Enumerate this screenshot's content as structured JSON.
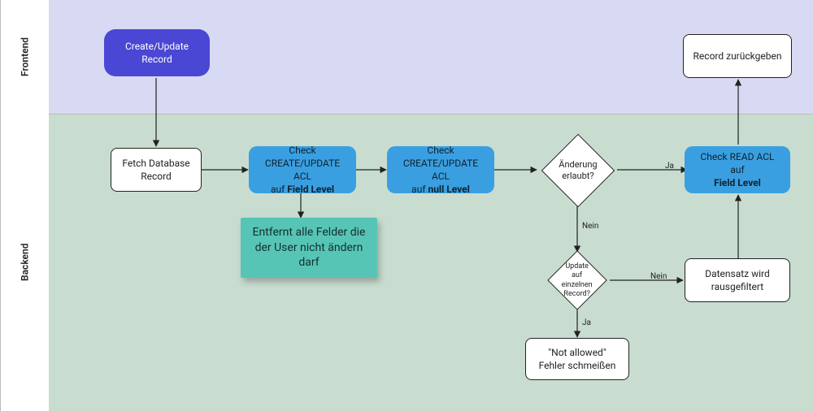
{
  "lanes": {
    "frontend": "Frontend",
    "backend": "Backend"
  },
  "nodes": {
    "create_update": "Create/Update Record",
    "fetch_db": "Fetch Database Record",
    "check_field_acl_pre": "Check",
    "check_field_acl_line2": "CREATE/UPDATE ACL",
    "check_field_acl_line3_a": "auf ",
    "check_field_acl_line3_b": "Field Level",
    "check_null_acl_pre": "Check",
    "check_null_acl_line2": "CREATE/UPDATE ACL",
    "check_null_acl_line3_a": "auf ",
    "check_null_acl_line3_b": "null Level",
    "sticky_note": "Entfernt alle Felder die der User nicht ändern darf",
    "change_allowed": "Änderung erlaubt?",
    "single_record": "Update auf einzelnen Record?",
    "not_allowed": "\"Not allowed\" Fehler schmeißen",
    "filtered_out": "Datensatz wird rausgefiltert",
    "check_read_acl_a": "Check READ ACL auf",
    "check_read_acl_b": "Field Level",
    "return_record": "Record zurückgeben"
  },
  "edges": {
    "yes": "Ja",
    "no": "Nein"
  },
  "chart_data": {
    "type": "flowchart",
    "title": "ACL Check Flow for Record Create/Update",
    "lanes": [
      {
        "id": "frontend",
        "label": "Frontend"
      },
      {
        "id": "backend",
        "label": "Backend"
      }
    ],
    "nodes": [
      {
        "id": "create_update",
        "lane": "frontend",
        "type": "process-start",
        "label": "Create/Update Record"
      },
      {
        "id": "fetch_db",
        "lane": "backend",
        "type": "process",
        "label": "Fetch Database Record"
      },
      {
        "id": "check_field_acl",
        "lane": "backend",
        "type": "process",
        "label": "Check CREATE/UPDATE ACL auf Field Level"
      },
      {
        "id": "sticky",
        "lane": "backend",
        "type": "note",
        "label": "Entfernt alle Felder die der User nicht ändern darf"
      },
      {
        "id": "check_null_acl",
        "lane": "backend",
        "type": "process",
        "label": "Check CREATE/UPDATE ACL auf null Level"
      },
      {
        "id": "change_allowed",
        "lane": "backend",
        "type": "decision",
        "label": "Änderung erlaubt?"
      },
      {
        "id": "single_record",
        "lane": "backend",
        "type": "decision",
        "label": "Update auf einzelnen Record?"
      },
      {
        "id": "not_allowed",
        "lane": "backend",
        "type": "process",
        "label": "\"Not allowed\" Fehler schmeißen"
      },
      {
        "id": "filtered_out",
        "lane": "backend",
        "type": "process",
        "label": "Datensatz wird rausgefiltert"
      },
      {
        "id": "check_read_acl",
        "lane": "backend",
        "type": "process",
        "label": "Check READ ACL auf Field Level"
      },
      {
        "id": "return_record",
        "lane": "frontend",
        "type": "process-end",
        "label": "Record zurückgeben"
      }
    ],
    "edges": [
      {
        "from": "create_update",
        "to": "fetch_db"
      },
      {
        "from": "fetch_db",
        "to": "check_field_acl"
      },
      {
        "from": "check_field_acl",
        "to": "sticky",
        "style": "note"
      },
      {
        "from": "check_field_acl",
        "to": "check_null_acl"
      },
      {
        "from": "check_null_acl",
        "to": "change_allowed"
      },
      {
        "from": "change_allowed",
        "to": "check_read_acl",
        "label": "Ja"
      },
      {
        "from": "change_allowed",
        "to": "single_record",
        "label": "Nein"
      },
      {
        "from": "single_record",
        "to": "not_allowed",
        "label": "Ja"
      },
      {
        "from": "single_record",
        "to": "filtered_out",
        "label": "Nein"
      },
      {
        "from": "filtered_out",
        "to": "check_read_acl"
      },
      {
        "from": "check_read_acl",
        "to": "return_record"
      }
    ]
  }
}
